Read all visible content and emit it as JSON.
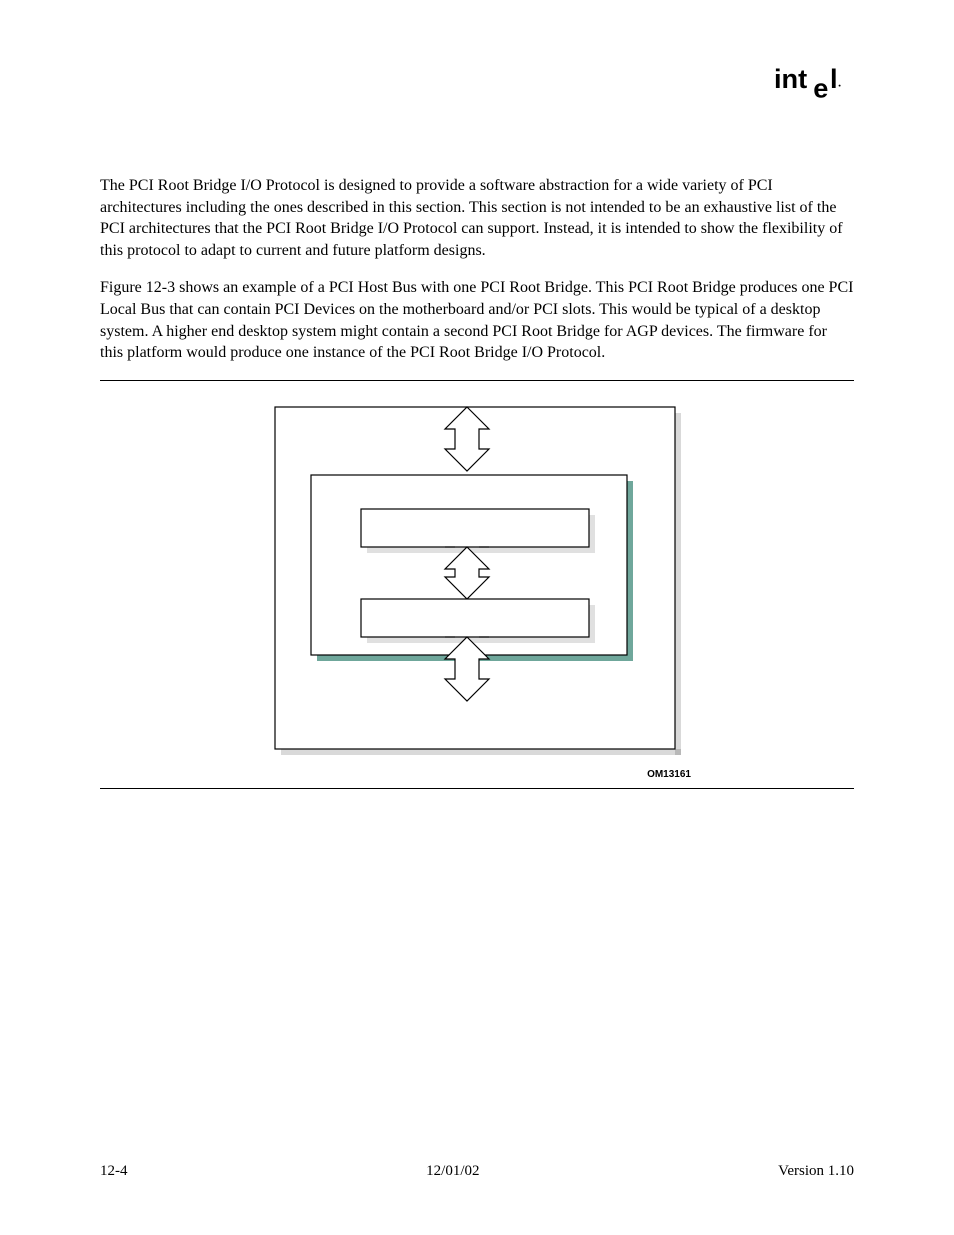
{
  "logo_text": "intel",
  "paragraphs": {
    "p1": "The PCI Root Bridge I/O Protocol is designed to provide a software abstraction for a wide variety of PCI architectures including the ones described in this section.  This section is not intended to be an exhaustive list of the PCI architectures that the PCI Root Bridge I/O Protocol can support.  Instead, it is intended to show the flexibility of this protocol to adapt to current and future platform designs.",
    "p2": "Figure 12-3 shows an example of a PCI Host Bus with one PCI Root Bridge.  This PCI Root Bridge produces one PCI Local Bus that can contain PCI Devices on the motherboard and/or PCI slots.  This would be typical of a desktop system.  A higher end desktop system might contain a second PCI Root Bridge for AGP devices.  The firmware for this platform would produce one instance of the PCI Root Bridge I/O Protocol."
  },
  "figure": {
    "om_code": "OM13161"
  },
  "footer": {
    "left": "12-4",
    "center": "12/01/02",
    "right": "Version 1.10"
  }
}
